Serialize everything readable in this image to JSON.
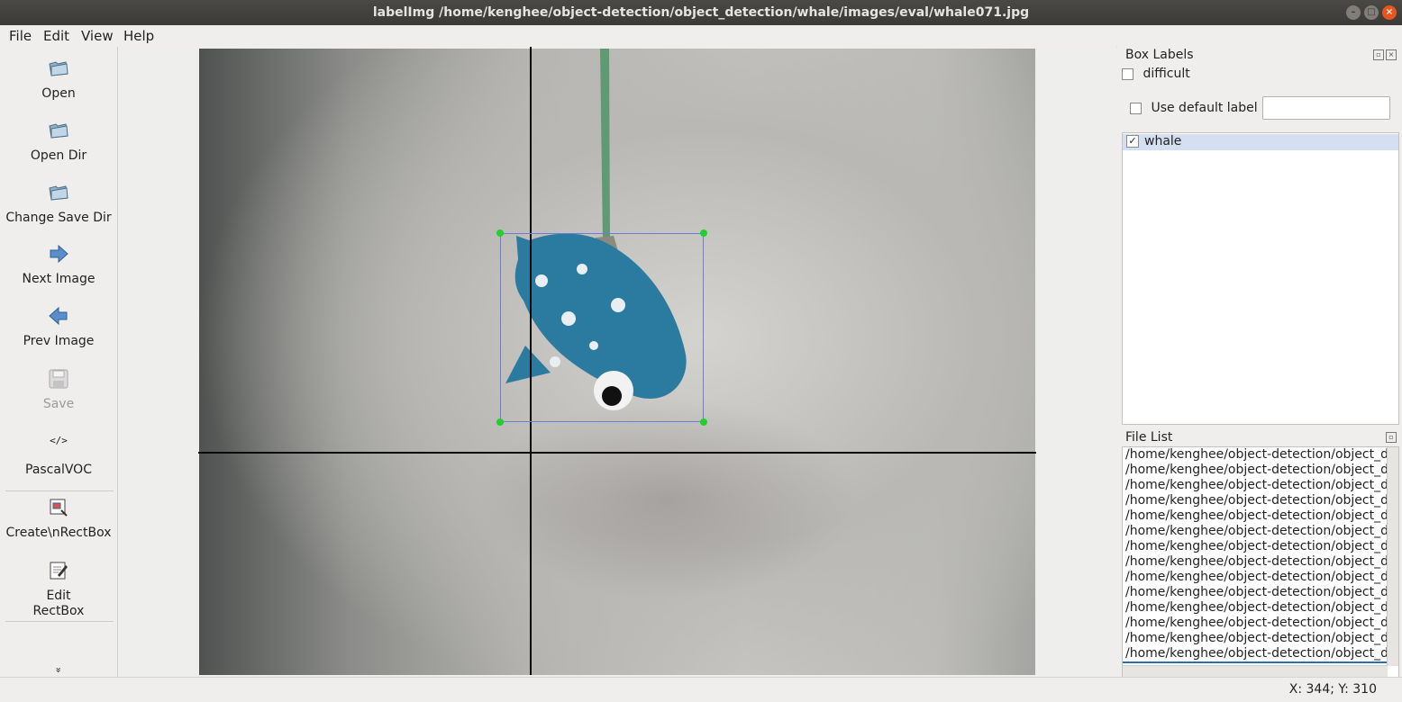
{
  "window": {
    "title": "labelImg /home/kenghee/object-detection/object_detection/whale/images/eval/whale071.jpg"
  },
  "menu": {
    "file": "File",
    "edit": "Edit",
    "view": "View",
    "help": "Help"
  },
  "toolbar": {
    "open": "Open",
    "open_dir": "Open Dir",
    "change_save_dir": "Change Save Dir",
    "next_image": "Next Image",
    "prev_image": "Prev Image",
    "save": "Save",
    "format_icon_text": "</>",
    "format": "PascalVOC",
    "create_rectbox": "Create\\nRectBox",
    "edit_rectbox_line1": "Edit",
    "edit_rectbox_line2": "RectBox",
    "more": "»"
  },
  "box_labels": {
    "title": "Box Labels",
    "difficult": "difficult",
    "use_default_label": "Use default label",
    "default_label_value": "",
    "labels": [
      {
        "name": "whale",
        "checked": true
      }
    ]
  },
  "file_list": {
    "title": "File List",
    "items": [
      "/home/kenghee/object-detection/object_d",
      "/home/kenghee/object-detection/object_d",
      "/home/kenghee/object-detection/object_d",
      "/home/kenghee/object-detection/object_d",
      "/home/kenghee/object-detection/object_d",
      "/home/kenghee/object-detection/object_d",
      "/home/kenghee/object-detection/object_d",
      "/home/kenghee/object-detection/object_d",
      "/home/kenghee/object-detection/object_d",
      "/home/kenghee/object-detection/object_d",
      "/home/kenghee/object-detection/object_d",
      "/home/kenghee/object-detection/object_d",
      "/home/kenghee/object-detection/object_d",
      "/home/kenghee/object-detection/object_d"
    ]
  },
  "status": {
    "coords": "X: 344; Y: 310"
  }
}
